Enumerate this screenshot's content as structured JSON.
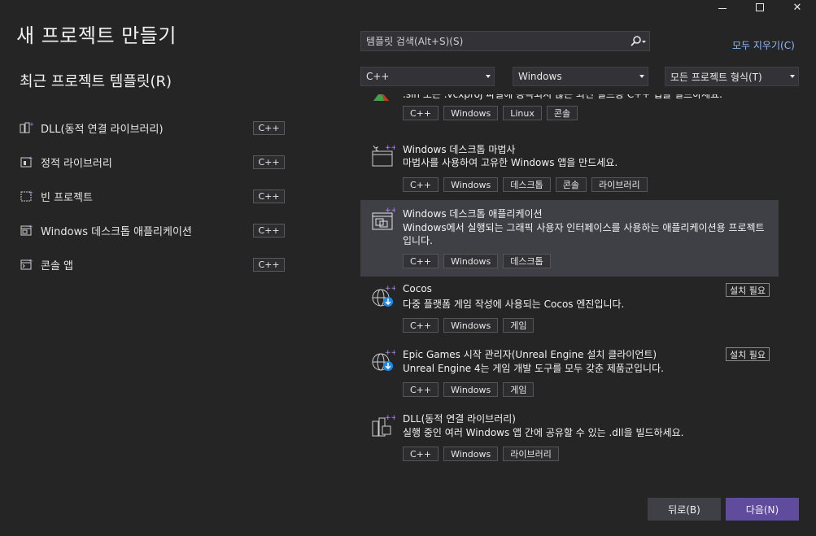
{
  "window": {
    "minimize_icon": "minimize-icon",
    "maximize_icon": "maximize-icon",
    "close_glyph": "✕"
  },
  "title": "새 프로젝트 만들기",
  "recent": {
    "heading": "최근 프로젝트 템플릿(R)",
    "items": [
      {
        "label": "DLL(동적 연결 라이브러리)",
        "tag": "C++"
      },
      {
        "label": "정적 라이브러리",
        "tag": "C++"
      },
      {
        "label": "빈 프로젝트",
        "tag": "C++"
      },
      {
        "label": "Windows 데스크톱 애플리케이션",
        "tag": "C++"
      },
      {
        "label": "콘솔 앱",
        "tag": "C++"
      }
    ]
  },
  "search": {
    "placeholder": "템플릿 검색(Alt+S)(S)",
    "icon": "search-icon"
  },
  "clear_all": "모두 지우기(C)",
  "filters": {
    "language": "C++",
    "platform": "Windows",
    "project_type": "모든 프로젝트 형식(T)"
  },
  "templates": [
    {
      "name": "",
      "desc": ".sln 또는 .vcxproj 파일에 종속되지 않는 최신 빌드용 C++ 앱을 빌드하세요.",
      "tags": [
        "C++",
        "Windows",
        "Linux",
        "콘솔"
      ]
    },
    {
      "name": "Windows 데스크톱 마법사",
      "desc": "마법사를 사용하여 고유한 Windows 앱을 만드세요.",
      "tags": [
        "C++",
        "Windows",
        "데스크톱",
        "콘솔",
        "라이브러리"
      ]
    },
    {
      "name": "Windows 데스크톱 애플리케이션",
      "desc": "Windows에서 실행되는 그래픽 사용자 인터페이스를 사용하는 애플리케이션용 프로젝트입니다.",
      "tags": [
        "C++",
        "Windows",
        "데스크톱"
      ],
      "selected": true
    },
    {
      "name": "Cocos",
      "desc": "다중 플랫폼 게임 작성에 사용되는 Cocos 엔진입니다.",
      "tags": [
        "C++",
        "Windows",
        "게임"
      ],
      "install": "설치 필요"
    },
    {
      "name": "Epic Games 시작 관리자(Unreal Engine 설치 클라이언트)",
      "desc": "Unreal Engine 4는 게임 개발 도구를 모두 갖춘 제품군입니다.",
      "tags": [
        "C++",
        "Windows",
        "게임"
      ],
      "install": "설치 필요"
    },
    {
      "name": "DLL(동적 연결 라이브러리)",
      "desc": "실행 중인 여러 Windows 앱 간에 공유할 수 있는 .dll을 빌드하세요.",
      "tags": [
        "C++",
        "Windows",
        "라이브러리"
      ]
    }
  ],
  "buttons": {
    "back": "뒤로(B)",
    "next": "다음(N)"
  },
  "colors": {
    "background": "#252526",
    "selected_row": "#3f3f46",
    "primary_button": "#5f4c9c",
    "link": "#8fb8ff"
  }
}
